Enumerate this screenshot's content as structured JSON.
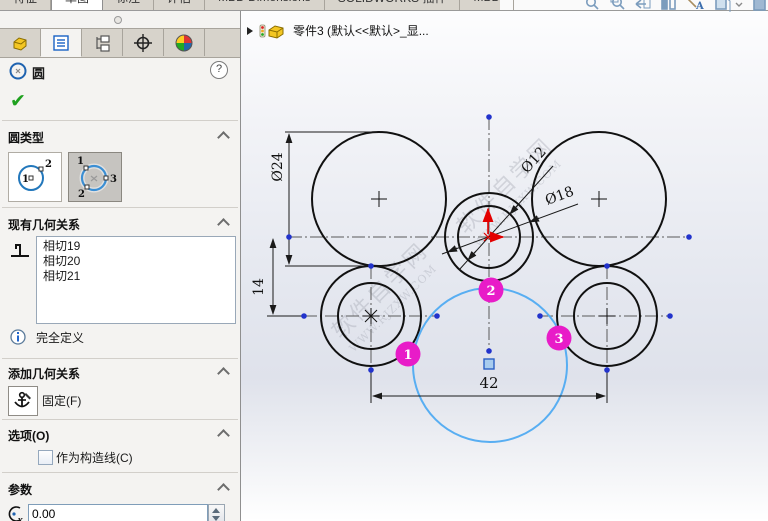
{
  "tabs": {
    "items": [
      {
        "label": "特征"
      },
      {
        "label": "草图"
      },
      {
        "label": "标注"
      },
      {
        "label": "评估"
      },
      {
        "label": "MBD Dimensions"
      },
      {
        "label": "SOLIDWORKS 插件"
      },
      {
        "label": "MBD"
      }
    ]
  },
  "panel": {
    "title": "圆",
    "ok": "✔",
    "help": "?",
    "circle_type": {
      "header": "圆类型",
      "buttons": [
        {
          "name": "center-circle",
          "points": [
            "1",
            "2"
          ]
        },
        {
          "name": "perimeter-circle",
          "selected": true,
          "points": [
            "1",
            "2",
            "3"
          ]
        }
      ]
    },
    "existing_relations": {
      "header": "现有几何关系",
      "items": [
        "相切19",
        "相切20",
        "相切21"
      ],
      "status": "完全定义"
    },
    "add_relations": {
      "header": "添加几何关系",
      "fix": "固定(F)"
    },
    "options": {
      "header": "选项(O)",
      "construction": "作为构造线(C)",
      "checked": false
    },
    "parameters": {
      "header": "参数",
      "x": "0.00"
    }
  },
  "viewport": {
    "tree": "零件3 (默认<<默认>_显...",
    "watermark1": "软件自学网",
    "watermark2": "WWW.RJZXW.COM",
    "dims": {
      "d24": "Ø24",
      "d12": "Ø12",
      "d18": "Ø18",
      "v14": "14",
      "h42": "42"
    },
    "badges": [
      "1",
      "2",
      "3"
    ]
  },
  "colors": {
    "preview_circle": "#58aef2",
    "badge": "#e81cc8",
    "origin": "#e30000",
    "sketch_point": "#2233cc"
  }
}
